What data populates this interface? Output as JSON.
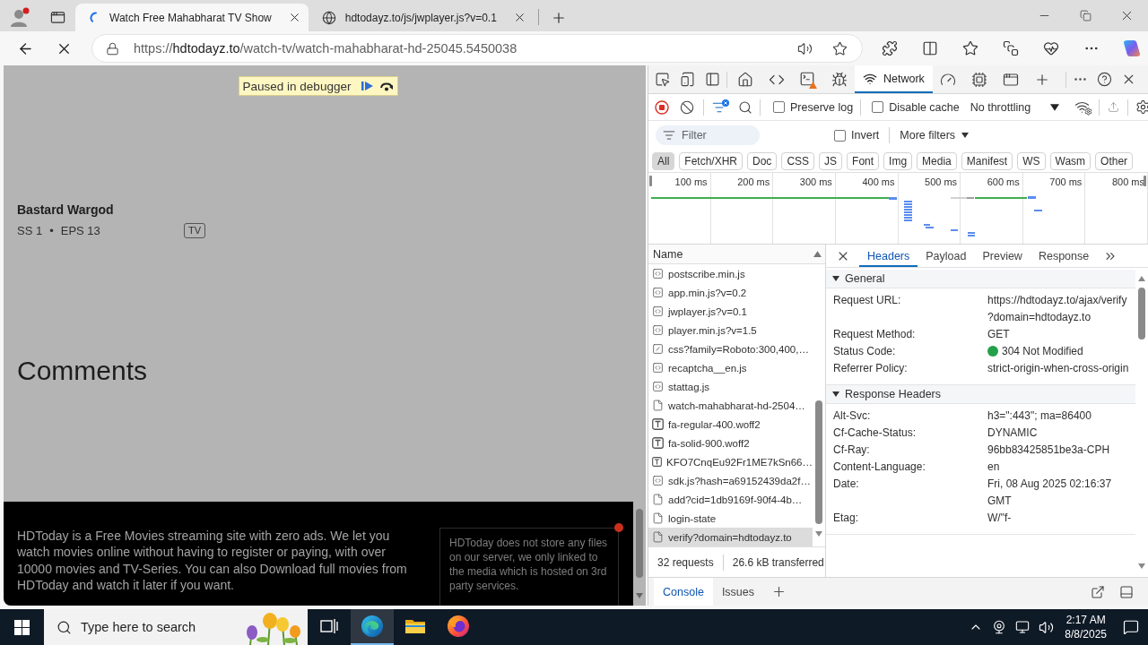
{
  "browser": {
    "tabs": [
      {
        "title": "Watch Free Mahabharat TV Show",
        "loading": true,
        "selected": true
      },
      {
        "title": "hdtodayz.to/js/jwplayer.js?v=0.1",
        "loading": false,
        "selected": false
      }
    ],
    "address": {
      "scheme": "https://",
      "host": "hdtodayz.to",
      "path": "/watch-tv/watch-mahabharat-hd-25045.5450038"
    },
    "page_loading": true
  },
  "page": {
    "debugger_banner": "Paused in debugger",
    "show": {
      "title": "Bastard Wargod",
      "season": "SS 1",
      "separator": "•",
      "episodes": "EPS 13",
      "type": "TV"
    },
    "comments_heading": "Comments",
    "footer": {
      "about": "HDToday is a Free Movies streaming site with zero ads. We let you watch movies online without having to register or paying, with over 10000 movies and TV-Series. You can also Download full movies from HDToday and watch it later if you want.",
      "disclaimer": "HDToday does not store any files on our server, we only linked to the media which is hosted on 3rd party services."
    }
  },
  "devtools": {
    "network_tab": {
      "label": "Network",
      "selected": true
    },
    "toolbar": {
      "recording": true,
      "preserve_log": {
        "label": "Preserve log",
        "checked": false
      },
      "disable_cache": {
        "label": "Disable cache",
        "checked": false
      },
      "throttling": "No throttling"
    },
    "filter": {
      "placeholder": "Filter",
      "invert": {
        "label": "Invert",
        "checked": false
      },
      "more_filters": "More filters"
    },
    "type_filters": [
      {
        "label": "All",
        "selected": true
      },
      {
        "label": "Fetch/XHR",
        "selected": false
      },
      {
        "label": "Doc",
        "selected": false
      },
      {
        "label": "CSS",
        "selected": false
      },
      {
        "label": "JS",
        "selected": false
      },
      {
        "label": "Font",
        "selected": false
      },
      {
        "label": "Img",
        "selected": false
      },
      {
        "label": "Media",
        "selected": false
      },
      {
        "label": "Manifest",
        "selected": false
      },
      {
        "label": "WS",
        "selected": false
      },
      {
        "label": "Wasm",
        "selected": false
      },
      {
        "label": "Other",
        "selected": false
      }
    ],
    "timeline": {
      "ticks": [
        "100 ms",
        "200 ms",
        "300 ms",
        "400 ms",
        "500 ms",
        "600 ms",
        "700 ms",
        "800 ms"
      ]
    },
    "requests": {
      "column": "Name",
      "items": [
        {
          "name": "postscribe.min.js",
          "kind": "script",
          "selected": false
        },
        {
          "name": "app.min.js?v=0.2",
          "kind": "script",
          "selected": false
        },
        {
          "name": "jwplayer.js?v=0.1",
          "kind": "script",
          "selected": false
        },
        {
          "name": "player.min.js?v=1.5",
          "kind": "script",
          "selected": false
        },
        {
          "name": "css?family=Roboto:300,400,…",
          "kind": "stylesheet",
          "selected": false
        },
        {
          "name": "recaptcha__en.js",
          "kind": "script",
          "selected": false
        },
        {
          "name": "stattag.js",
          "kind": "script",
          "selected": false
        },
        {
          "name": "watch-mahabharat-hd-2504…",
          "kind": "document",
          "selected": false
        },
        {
          "name": "fa-regular-400.woff2",
          "kind": "font",
          "selected": false
        },
        {
          "name": "fa-solid-900.woff2",
          "kind": "font",
          "selected": false
        },
        {
          "name": "KFO7CnqEu92Fr1ME7kSn66…",
          "kind": "font",
          "selected": false
        },
        {
          "name": "sdk.js?hash=a69152439da2f…",
          "kind": "script",
          "selected": false
        },
        {
          "name": "add?cid=1db9169f-90f4-4b…",
          "kind": "document",
          "selected": false
        },
        {
          "name": "login-state",
          "kind": "document",
          "selected": false
        },
        {
          "name": "verify?domain=hdtodayz.to",
          "kind": "document",
          "selected": true
        }
      ]
    },
    "summary": {
      "requests": "32 requests",
      "transferred": "26.6 kB transferred"
    },
    "details": {
      "tabs": [
        {
          "label": "Headers",
          "selected": true
        },
        {
          "label": "Payload",
          "selected": false
        },
        {
          "label": "Preview",
          "selected": false
        },
        {
          "label": "Response",
          "selected": false
        }
      ],
      "sections": [
        {
          "title": "General",
          "expanded": true,
          "rows": [
            {
              "key": "Request URL:",
              "value": "https://hdtodayz.to/ajax/verify?domain=hdtodayz.to"
            },
            {
              "key": "Request Method:",
              "value": "GET"
            },
            {
              "key": "Status Code:",
              "value": "304 Not Modified",
              "color": "#22a14a"
            },
            {
              "key": "Referrer Policy:",
              "value": "strict-origin-when-cross-origin"
            }
          ]
        },
        {
          "title": "Response Headers",
          "expanded": true,
          "rows": [
            {
              "key": "Alt-Svc:",
              "value": "h3=\":443\"; ma=86400"
            },
            {
              "key": "Cf-Cache-Status:",
              "value": "DYNAMIC"
            },
            {
              "key": "Cf-Ray:",
              "value": "96bb83425851be3a-CPH"
            },
            {
              "key": "Content-Language:",
              "value": "en"
            },
            {
              "key": "Date:",
              "value": "Fri, 08 Aug 2025 02:16:37 GMT"
            },
            {
              "key": "Etag:",
              "value": "W/\"f-"
            }
          ]
        }
      ]
    },
    "drawer_tabs": [
      {
        "label": "Console",
        "selected": true
      },
      {
        "label": "Issues",
        "selected": false
      }
    ]
  },
  "taskbar": {
    "search_placeholder": "Type here to search",
    "apps": [
      {
        "kind": "taskview",
        "active": false
      },
      {
        "kind": "edge",
        "active": true
      },
      {
        "kind": "explorer",
        "active": false
      },
      {
        "kind": "firefox",
        "active": false
      }
    ],
    "clock": {
      "time": "2:17 AM",
      "date": "8/8/2025"
    }
  }
}
